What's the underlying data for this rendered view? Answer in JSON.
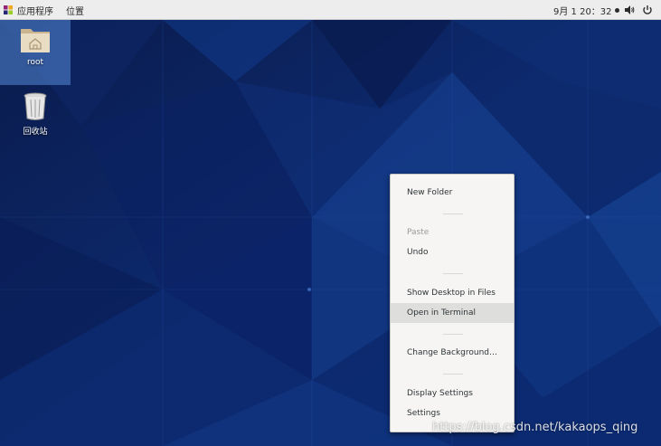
{
  "topbar": {
    "apps_menu": "应用程序",
    "places_menu": "位置",
    "clock": "9月 1 20：32",
    "volume_icon": "volume-icon",
    "power_icon": "power-icon"
  },
  "desktop": {
    "icons": [
      {
        "label": "root",
        "icon": "home-folder-icon",
        "selected": true
      },
      {
        "label": "回收站",
        "icon": "trash-icon",
        "selected": false
      }
    ]
  },
  "context_menu": {
    "items": [
      {
        "label": "New Folder",
        "disabled": false
      },
      {
        "label": "Paste",
        "disabled": true
      },
      {
        "label": "Undo",
        "disabled": false
      },
      {
        "label": "Show Desktop in Files",
        "disabled": false
      },
      {
        "label": "Open in Terminal",
        "disabled": false,
        "hover": true
      },
      {
        "label": "Change Background…",
        "disabled": false
      },
      {
        "label": "Display Settings",
        "disabled": false
      },
      {
        "label": "Settings",
        "disabled": false
      }
    ]
  },
  "watermark": "https://blog.csdn.net/kakaops_qing",
  "colors": {
    "wallpaper_base": "#0b1f55",
    "wallpaper_accent": "#1a4aa0",
    "menu_bg": "#f6f5f4",
    "menu_hover": "#dededd",
    "selection": "#416eb4"
  }
}
